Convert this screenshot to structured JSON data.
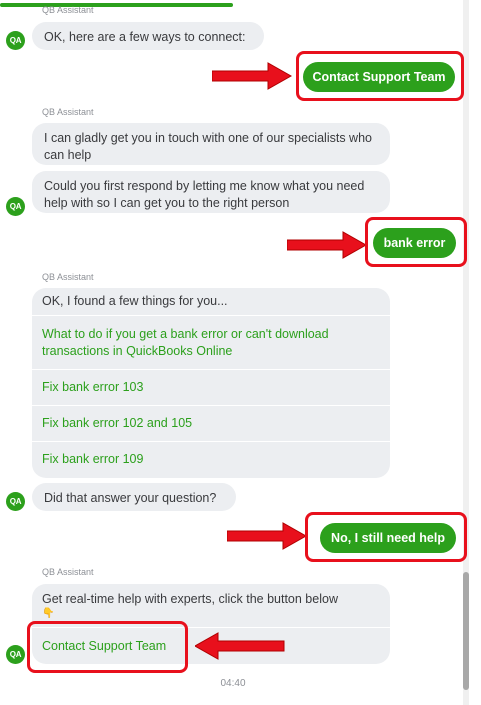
{
  "chat": {
    "sender_name": "QB Assistant",
    "avatar_initials": "QA",
    "accent_color": "#2ca01c",
    "highlight_color": "#e8101c",
    "progress": 0.5,
    "messages": {
      "connect_intro": "OK, here are a few ways to connect:",
      "contact_support_reply": "Contact Support Team",
      "specialist_line": "I can gladly get you in touch with one of our specialists who can help",
      "respond_line": "Could you first respond by letting me know what you need help with so I can get you to the right person",
      "bank_error_reply": "bank error",
      "found_things": "OK, I found a few things for you...",
      "links": [
        "What to do if you get a bank error or can't download transactions in QuickBooks Online",
        "Fix bank error 103",
        "Fix bank error 102 and 105",
        "Fix bank error 109"
      ],
      "answer_question": "Did that answer your question?",
      "still_need_help_reply": "No, I still need help",
      "realtime_help": "Get real-time help with experts, click the button below",
      "realtime_emoji": "👇",
      "contact_support_button": "Contact Support Team"
    },
    "timestamp": "04:40"
  }
}
